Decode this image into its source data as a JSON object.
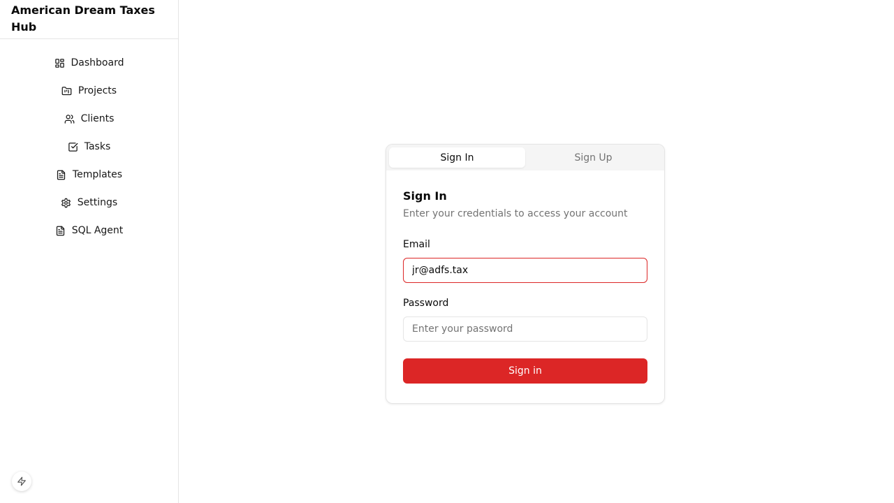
{
  "brand": {
    "title": "American Dream Taxes Hub"
  },
  "sidebar": {
    "items": [
      {
        "label": "Dashboard",
        "icon": "dashboard-icon"
      },
      {
        "label": "Projects",
        "icon": "folder-kanban-icon"
      },
      {
        "label": "Clients",
        "icon": "users-icon"
      },
      {
        "label": "Tasks",
        "icon": "check-square-icon"
      },
      {
        "label": "Templates",
        "icon": "file-text-icon"
      },
      {
        "label": "Settings",
        "icon": "gear-icon"
      },
      {
        "label": "SQL Agent",
        "icon": "file-text-icon"
      }
    ]
  },
  "auth": {
    "tabs": [
      {
        "label": "Sign In",
        "active": true
      },
      {
        "label": "Sign Up",
        "active": false
      }
    ],
    "title": "Sign In",
    "description": "Enter your credentials to access your account",
    "email_label": "Email",
    "email_value": "jr@adfs.tax",
    "password_label": "Password",
    "password_placeholder": "Enter your password",
    "submit_label": "Sign in"
  },
  "floating_button": {
    "icon": "lightning-icon"
  },
  "colors": {
    "accent": "#dc2626",
    "border": "#e5e5e5",
    "muted": "#737373"
  }
}
